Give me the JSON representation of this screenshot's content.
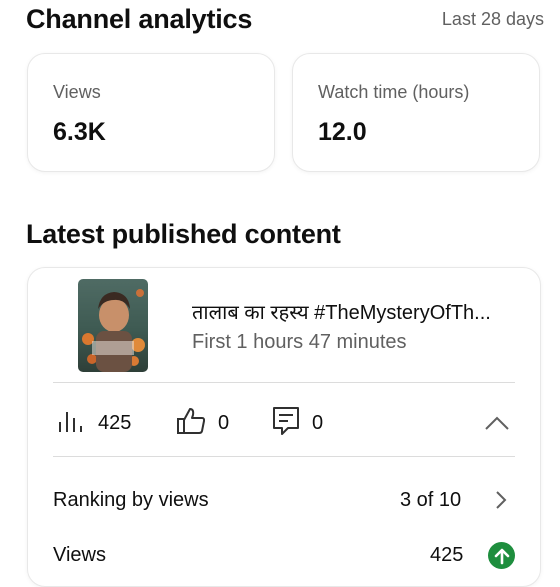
{
  "header": {
    "title": "Channel analytics",
    "period": "Last 28 days"
  },
  "stats": [
    {
      "label": "Views",
      "value": "6.3K"
    },
    {
      "label": "Watch time (hours)",
      "value": "12.0"
    }
  ],
  "latest": {
    "section_title": "Latest published content",
    "video": {
      "title": "तालाब का रहस्य #TheMysteryOfTh...",
      "subtitle": "First 1 hours 47 minutes",
      "views": "425",
      "likes": "0",
      "comments": "0"
    },
    "ranking": {
      "label": "Ranking by views",
      "value": "3 of 10"
    },
    "views_row": {
      "label": "Views",
      "value": "425"
    }
  },
  "icons": {
    "views": "bar-chart-icon",
    "likes": "thumbs-up-icon",
    "comments": "comment-icon",
    "collapse": "chevron-up-icon",
    "ranking": "chevron-right-icon",
    "trend": "arrow-up-circle-icon"
  },
  "colors": {
    "trend_up": "#1e8e3e",
    "secondary_text": "#606060"
  }
}
